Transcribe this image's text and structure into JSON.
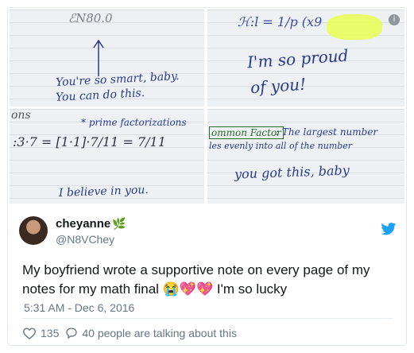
{
  "photos": {
    "top_left": {
      "math_top": "ℰN80.0",
      "line1": "You're so smart, baby.",
      "line2": "You can do this."
    },
    "top_right": {
      "formula": "ℋ:l = 1/p (x9",
      "line1": "I'm so proud",
      "line2": "of you!",
      "info_badge": "i"
    },
    "bottom_left": {
      "corner": "ons",
      "heading": "* prime factorizations",
      "math": ":3·7 = [1·1]·7/11 = 7/11",
      "message": "I believe in you."
    },
    "bottom_right": {
      "term": "ommon Factor",
      "definition_line1": ": The largest number",
      "definition_line2": "les evenly into all of the number",
      "message": "you got this, baby"
    }
  },
  "tweet": {
    "display_name": "cheyanne",
    "name_emoji": "🌿",
    "handle": "@N8VChey",
    "text": "My boyfriend wrote a supportive note on every page of my notes for my math final 😭💖💖 I'm so lucky",
    "timestamp": "5:31 AM - Dec 6, 2016",
    "likes": "135",
    "conversation": "40 people are talking about this"
  },
  "colors": {
    "twitter_blue": "#1da1f2",
    "ink": "#2b3a8a",
    "muted": "#657786"
  }
}
